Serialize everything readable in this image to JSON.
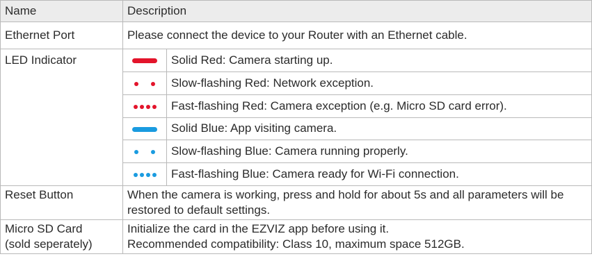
{
  "header": {
    "name": "Name",
    "description": "Description"
  },
  "ethernet": {
    "name": "Ethernet Port",
    "description": "Please connect the device to your Router with an Ethernet cable."
  },
  "led": {
    "name": "LED Indicator",
    "states": [
      {
        "pattern": "solid",
        "color": "#e3142b",
        "text": "Solid Red: Camera starting up."
      },
      {
        "pattern": "slow",
        "color": "#e3142b",
        "text": "Slow-flashing Red: Network exception."
      },
      {
        "pattern": "fast",
        "color": "#e3142b",
        "text": "Fast-flashing Red: Camera exception (e.g. Micro SD card error)."
      },
      {
        "pattern": "solid",
        "color": "#1a9be0",
        "text": "Solid Blue: App visiting camera."
      },
      {
        "pattern": "slow",
        "color": "#1a9be0",
        "text": "Slow-flashing Blue: Camera running properly."
      },
      {
        "pattern": "fast",
        "color": "#1a9be0",
        "text": "Fast-flashing Blue: Camera ready for Wi-Fi connection."
      }
    ]
  },
  "reset": {
    "name": "Reset Button",
    "description": "When the camera is working, press and hold for about 5s and all parameters will be restored to default settings."
  },
  "microsd": {
    "name_line1": "Micro SD Card",
    "name_line2": "(sold seperately)",
    "desc_line1": "Initialize the card in the EZVIZ app before using it.",
    "desc_line2": "Recommended compatibility: Class 10, maximum space 512GB."
  }
}
